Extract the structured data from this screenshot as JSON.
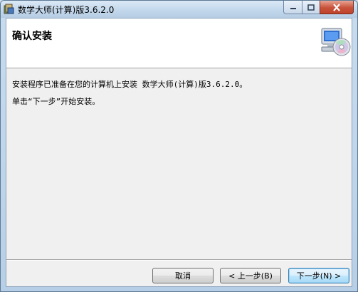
{
  "window": {
    "title": "数学大师(计算)版3.6.2.0"
  },
  "banner": {
    "title": "确认安装"
  },
  "body": {
    "line1": "安装程序已准备在您的计算机上安装 数学大师(计算)版3.6.2.0。",
    "line2": "单击“下一步”开始安装。"
  },
  "buttons": {
    "cancel": "取消",
    "back": "< 上一步(B)",
    "next": "下一步(N) >"
  },
  "icons": {
    "app": "installer-app-icon",
    "banner": "computer-cd-icon"
  }
}
